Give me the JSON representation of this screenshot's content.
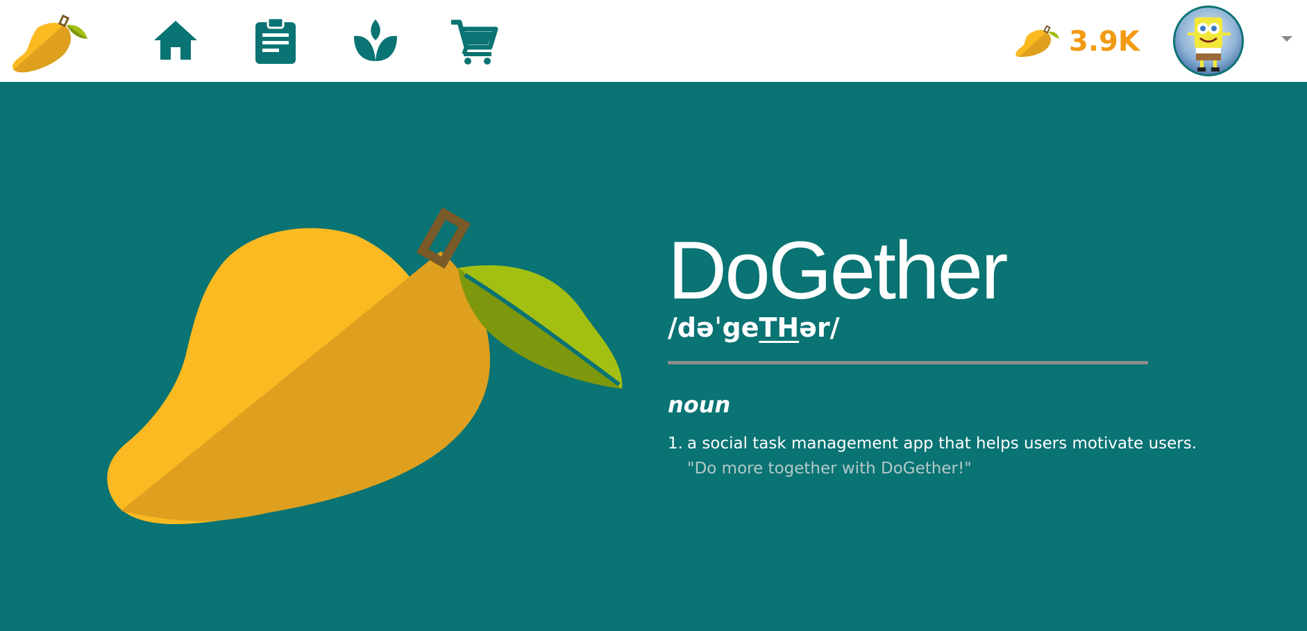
{
  "header": {
    "logo_icon": "mango-logo-icon",
    "nav": [
      {
        "name": "home",
        "icon": "home-icon"
      },
      {
        "name": "tasks",
        "icon": "clipboard-icon"
      },
      {
        "name": "garden",
        "icon": "sprout-icon"
      },
      {
        "name": "shop",
        "icon": "cart-icon"
      }
    ],
    "coin_icon": "mango-coin-icon",
    "coin_count": "3.9K",
    "avatar_icon": "user-avatar",
    "dropdown_icon": "caret-down-icon"
  },
  "definition": {
    "word": "DoGether",
    "phonetic_start": "/dəˈge",
    "phonetic_underlined": "TH",
    "phonetic_end": "ər/",
    "part_of_speech": "noun",
    "number": "1.",
    "meaning": "a social task management app that helps users motivate users.",
    "example": "\"Do more together with DoGether!\""
  },
  "colors": {
    "brand_teal": "#0a7373",
    "coin_orange": "#f19a12",
    "mango_light": "#fbba22",
    "mango_dark": "#dea01e",
    "leaf_light": "#a3bf12",
    "leaf_dark": "#7e980d",
    "stem": "#7a5a28"
  }
}
